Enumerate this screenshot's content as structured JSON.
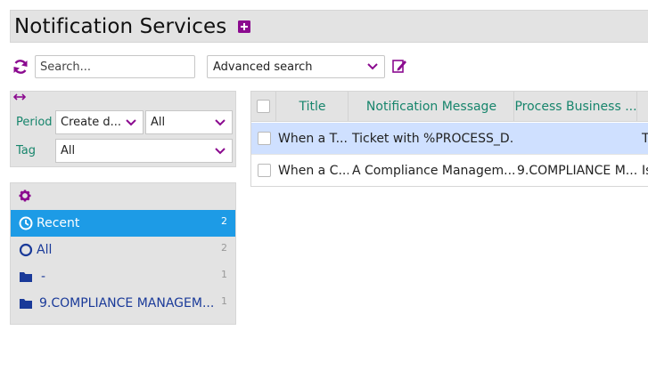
{
  "header": {
    "title": "Notification Services"
  },
  "toolbar": {
    "search_placeholder": "Search...",
    "advanced_search_label": "Advanced search"
  },
  "filters": {
    "period_label": "Period",
    "period_field": "Create d...",
    "period_value": "All",
    "tag_label": "Tag",
    "tag_value": "All"
  },
  "categories": [
    {
      "label": "Recent",
      "count": "2",
      "icon": "clock-icon",
      "selected": true
    },
    {
      "label": "All",
      "count": "2",
      "icon": "circle-icon"
    },
    {
      "label": "-",
      "count": "1",
      "icon": "folder-icon"
    },
    {
      "label": "9.COMPLIANCE MANAGEM...",
      "count": "1",
      "icon": "folder-icon"
    }
  ],
  "table": {
    "columns": [
      "Title",
      "Notification Message",
      "Process Business ..."
    ],
    "rows": [
      {
        "title": "When a T...",
        "message": "Ticket with %PROCESS_D...",
        "process": "",
        "extra": "T",
        "selected": true
      },
      {
        "title": "When a C...",
        "message": "A Compliance Managem...",
        "process": "9.COMPLIANCE M...",
        "extra": "Is"
      }
    ]
  },
  "colors": {
    "accent": "#8b0a8f",
    "selected_blue": "#1d9be6",
    "header_green": "#17856c",
    "row_highlight": "#cfe0ff"
  }
}
